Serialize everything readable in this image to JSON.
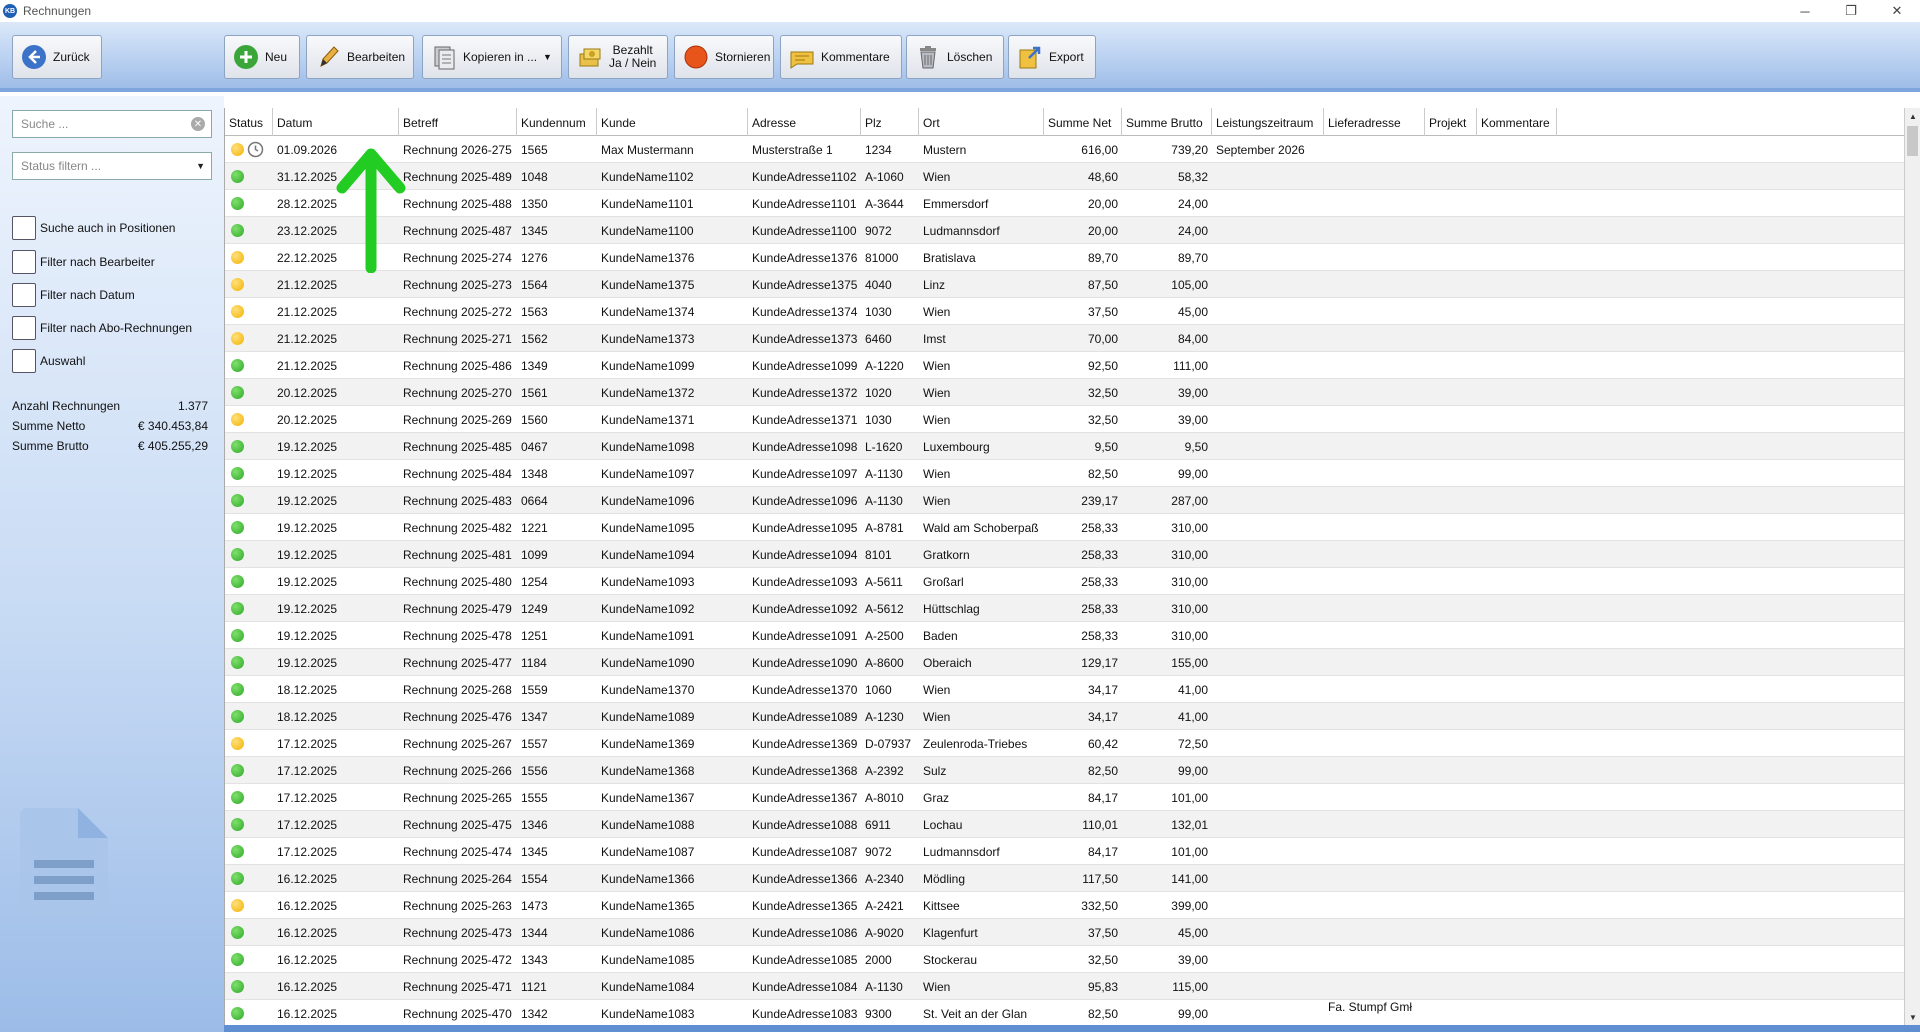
{
  "window": {
    "title": "Rechnungen",
    "logo": "KB",
    "controls": [
      "─",
      "❐",
      "✕"
    ]
  },
  "toolbar": {
    "back": "Zurück",
    "new": "Neu",
    "edit": "Bearbeiten",
    "copy": "Kopieren in ...",
    "paid_line1": "Bezahlt",
    "paid_line2": "Ja / Nein",
    "cancel": "Stornieren",
    "comments": "Kommentare",
    "delete": "Löschen",
    "export": "Export"
  },
  "sidebar": {
    "search_placeholder": "Suche ...",
    "status_placeholder": "Status filtern ...",
    "checkboxes": [
      "Suche auch in Positionen",
      "Filter nach Bearbeiter",
      "Filter nach Datum",
      "Filter nach Abo-Rechnungen",
      "Auswahl"
    ],
    "stats": [
      {
        "label": "Anzahl Rechnungen",
        "value": "1.377"
      },
      {
        "label": "Summe Netto",
        "value": "€ 340.453,84"
      },
      {
        "label": "Summe Brutto",
        "value": "€ 405.255,29"
      }
    ]
  },
  "colors": {
    "green": "#2fa82a",
    "yellow": "#f2b200",
    "accent": "#7fa6dc"
  },
  "table": {
    "columns": [
      "Status",
      "Datum",
      "Betreff",
      "Kundennum",
      "Kunde",
      "Adresse",
      "Plz",
      "Ort",
      "Summe Net",
      "Summe Brutto",
      "Leistungszeitraum",
      "Lieferadresse",
      "Projekt",
      "Kommentare"
    ],
    "rows": [
      [
        "yellow",
        "01.09.2026",
        "Rechnung 2026-275",
        "1565",
        "Max Mustermann",
        "Musterstraße 1",
        "1234",
        "Mustern",
        "616,00",
        "739,20",
        "September 2026",
        ""
      ],
      [
        "green",
        "31.12.2025",
        "Rechnung 2025-489",
        "1048",
        "KundeName1102",
        "KundeAdresse1102",
        "A-1060",
        "Wien",
        "48,60",
        "58,32",
        "",
        ""
      ],
      [
        "green",
        "28.12.2025",
        "Rechnung 2025-488",
        "1350",
        "KundeName1101",
        "KundeAdresse1101",
        "A-3644",
        "Emmersdorf",
        "20,00",
        "24,00",
        "",
        ""
      ],
      [
        "green",
        "23.12.2025",
        "Rechnung 2025-487",
        "1345",
        "KundeName1100",
        "KundeAdresse1100",
        "9072",
        "Ludmannsdorf",
        "20,00",
        "24,00",
        "",
        ""
      ],
      [
        "yellow",
        "22.12.2025",
        "Rechnung 2025-274",
        "1276",
        "KundeName1376",
        "KundeAdresse1376",
        "81000",
        "Bratislava",
        "89,70",
        "89,70",
        "",
        ""
      ],
      [
        "yellow",
        "21.12.2025",
        "Rechnung 2025-273",
        "1564",
        "KundeName1375",
        "KundeAdresse1375",
        "4040",
        "Linz",
        "87,50",
        "105,00",
        "",
        ""
      ],
      [
        "yellow",
        "21.12.2025",
        "Rechnung 2025-272",
        "1563",
        "KundeName1374",
        "KundeAdresse1374",
        "1030",
        "Wien",
        "37,50",
        "45,00",
        "",
        ""
      ],
      [
        "yellow",
        "21.12.2025",
        "Rechnung 2025-271",
        "1562",
        "KundeName1373",
        "KundeAdresse1373",
        "6460",
        "Imst",
        "70,00",
        "84,00",
        "",
        ""
      ],
      [
        "green",
        "21.12.2025",
        "Rechnung 2025-486",
        "1349",
        "KundeName1099",
        "KundeAdresse1099",
        "A-1220",
        "Wien",
        "92,50",
        "111,00",
        "",
        ""
      ],
      [
        "green",
        "20.12.2025",
        "Rechnung 2025-270",
        "1561",
        "KundeName1372",
        "KundeAdresse1372",
        "1020",
        "Wien",
        "32,50",
        "39,00",
        "",
        ""
      ],
      [
        "yellow",
        "20.12.2025",
        "Rechnung 2025-269",
        "1560",
        "KundeName1371",
        "KundeAdresse1371",
        "1030",
        "Wien",
        "32,50",
        "39,00",
        "",
        ""
      ],
      [
        "green",
        "19.12.2025",
        "Rechnung 2025-485",
        "0467",
        "KundeName1098",
        "KundeAdresse1098",
        "L-1620",
        "Luxembourg",
        "9,50",
        "9,50",
        "",
        ""
      ],
      [
        "green",
        "19.12.2025",
        "Rechnung 2025-484",
        "1348",
        "KundeName1097",
        "KundeAdresse1097",
        "A-1130",
        "Wien",
        "82,50",
        "99,00",
        "",
        ""
      ],
      [
        "green",
        "19.12.2025",
        "Rechnung 2025-483",
        "0664",
        "KundeName1096",
        "KundeAdresse1096",
        "A-1130",
        "Wien",
        "239,17",
        "287,00",
        "",
        ""
      ],
      [
        "green",
        "19.12.2025",
        "Rechnung 2025-482",
        "1221",
        "KundeName1095",
        "KundeAdresse1095",
        "A-8781",
        "Wald am Schoberpaß",
        "258,33",
        "310,00",
        "",
        ""
      ],
      [
        "green",
        "19.12.2025",
        "Rechnung 2025-481",
        "1099",
        "KundeName1094",
        "KundeAdresse1094",
        "8101",
        "Gratkorn",
        "258,33",
        "310,00",
        "",
        ""
      ],
      [
        "green",
        "19.12.2025",
        "Rechnung 2025-480",
        "1254",
        "KundeName1093",
        "KundeAdresse1093",
        "A-5611",
        "Großarl",
        "258,33",
        "310,00",
        "",
        ""
      ],
      [
        "green",
        "19.12.2025",
        "Rechnung 2025-479",
        "1249",
        "KundeName1092",
        "KundeAdresse1092",
        "A-5612",
        "Hüttschlag",
        "258,33",
        "310,00",
        "",
        ""
      ],
      [
        "green",
        "19.12.2025",
        "Rechnung 2025-478",
        "1251",
        "KundeName1091",
        "KundeAdresse1091",
        "A-2500",
        "Baden",
        "258,33",
        "310,00",
        "",
        ""
      ],
      [
        "green",
        "19.12.2025",
        "Rechnung 2025-477",
        "1184",
        "KundeName1090",
        "KundeAdresse1090",
        "A-8600",
        "Oberaich",
        "129,17",
        "155,00",
        "",
        ""
      ],
      [
        "green",
        "18.12.2025",
        "Rechnung 2025-268",
        "1559",
        "KundeName1370",
        "KundeAdresse1370",
        "1060",
        "Wien",
        "34,17",
        "41,00",
        "",
        ""
      ],
      [
        "green",
        "18.12.2025",
        "Rechnung 2025-476",
        "1347",
        "KundeName1089",
        "KundeAdresse1089",
        "A-1230",
        "Wien",
        "34,17",
        "41,00",
        "",
        ""
      ],
      [
        "yellow",
        "17.12.2025",
        "Rechnung 2025-267",
        "1557",
        "KundeName1369",
        "KundeAdresse1369",
        "D-07937",
        "Zeulenroda-Triebes",
        "60,42",
        "72,50",
        "",
        ""
      ],
      [
        "green",
        "17.12.2025",
        "Rechnung 2025-266",
        "1556",
        "KundeName1368",
        "KundeAdresse1368",
        "A-2392",
        "Sulz",
        "82,50",
        "99,00",
        "",
        ""
      ],
      [
        "green",
        "17.12.2025",
        "Rechnung 2025-265",
        "1555",
        "KundeName1367",
        "KundeAdresse1367",
        "A-8010",
        "Graz",
        "84,17",
        "101,00",
        "",
        ""
      ],
      [
        "green",
        "17.12.2025",
        "Rechnung 2025-475",
        "1346",
        "KundeName1088",
        "KundeAdresse1088",
        "6911",
        "Lochau",
        "110,01",
        "132,01",
        "",
        ""
      ],
      [
        "green",
        "17.12.2025",
        "Rechnung 2025-474",
        "1345",
        "KundeName1087",
        "KundeAdresse1087",
        "9072",
        "Ludmannsdorf",
        "84,17",
        "101,00",
        "",
        ""
      ],
      [
        "green",
        "16.12.2025",
        "Rechnung 2025-264",
        "1554",
        "KundeName1366",
        "KundeAdresse1366",
        "A-2340",
        "Mödling",
        "117,50",
        "141,00",
        "",
        ""
      ],
      [
        "yellow",
        "16.12.2025",
        "Rechnung 2025-263",
        "1473",
        "KundeName1365",
        "KundeAdresse1365",
        "A-2421",
        "Kittsee",
        "332,50",
        "399,00",
        "",
        ""
      ],
      [
        "green",
        "16.12.2025",
        "Rechnung 2025-473",
        "1344",
        "KundeName1086",
        "KundeAdresse1086",
        "A-9020",
        "Klagenfurt",
        "37,50",
        "45,00",
        "",
        ""
      ],
      [
        "green",
        "16.12.2025",
        "Rechnung 2025-472",
        "1343",
        "KundeName1085",
        "KundeAdresse1085",
        "2000",
        "Stockerau",
        "32,50",
        "39,00",
        "",
        ""
      ],
      [
        "green",
        "16.12.2025",
        "Rechnung 2025-471",
        "1121",
        "KundeName1084",
        "KundeAdresse1084",
        "A-1130",
        "Wien",
        "95,83",
        "115,00",
        "",
        ""
      ],
      [
        "green",
        "16.12.2025",
        "Rechnung 2025-470",
        "1342",
        "KundeName1083",
        "KundeAdresse1083",
        "9300",
        "St. Veit an der Glan",
        "82,50",
        "99,00",
        "",
        "Fa. Stumpf Gmł"
      ]
    ]
  }
}
